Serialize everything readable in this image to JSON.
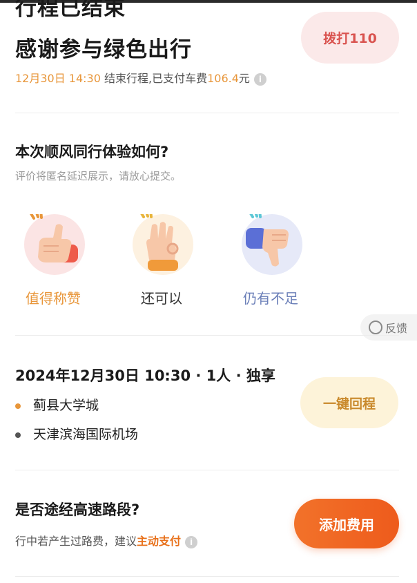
{
  "header": {
    "status_title": "行程已结束",
    "thanks_title": "感谢参与绿色出行",
    "end_time": "12月30日 14:30",
    "summary_mid": " 结束行程,已支付车费",
    "fare": "106.4",
    "fare_unit": "元",
    "call_label": "拨打110"
  },
  "rating": {
    "question": "本次顺风同行体验如何?",
    "hint": "评价将匿名延迟展示，请放心提交。",
    "options": [
      {
        "label": "值得称赞",
        "icon": "thumbs-up-icon",
        "color": "#e8963a"
      },
      {
        "label": "还可以",
        "icon": "ok-hand-icon",
        "color": "#333333"
      },
      {
        "label": "仍有不足",
        "icon": "thumbs-down-icon",
        "color": "#6b7fb8"
      }
    ],
    "feedback_label": "反馈"
  },
  "trip": {
    "datetime_line": "2024年12月30日 10:30 · 1人 · 独享",
    "origin": "蓟县大学城",
    "destination": "天津滨海国际机场",
    "origin_dot_color": "#e8963a",
    "destination_dot_color": "#555555",
    "return_label": "一键回程"
  },
  "highway": {
    "question": "是否途经高速路段?",
    "hint_prefix": "行中若产生过路费，建议",
    "hint_emphasis": "主动支付",
    "add_fee_label": "添加费用"
  }
}
